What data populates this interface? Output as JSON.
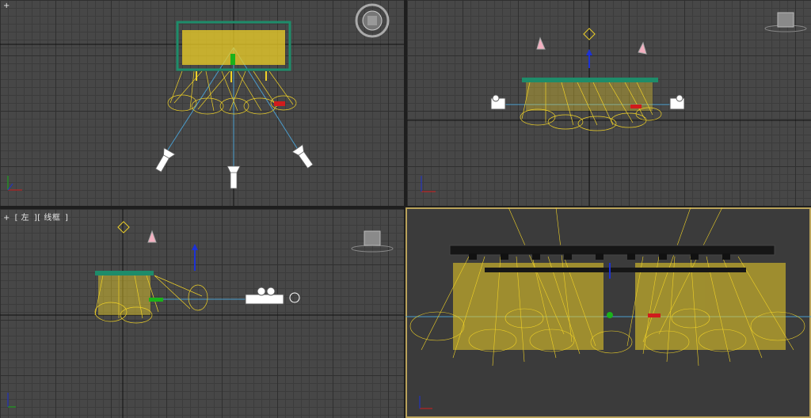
{
  "viewports": {
    "left": {
      "label_plus": "+",
      "label_view": "左",
      "label_shading": "线框"
    }
  },
  "colors": {
    "grid_bg": "#474747",
    "light_rig": "#f0d227",
    "truss": "#1e8c6a",
    "axis_x": "#d01c1c",
    "axis_y": "#1ab21a",
    "axis_z": "#1c31d6",
    "target_line": "#4a9ccc",
    "active_border": "#b9a25a"
  },
  "icons": [
    "viewcube-icon",
    "steering-wheel-icon",
    "axis-tripod-icon",
    "spotlight-icon",
    "camera-icon"
  ]
}
